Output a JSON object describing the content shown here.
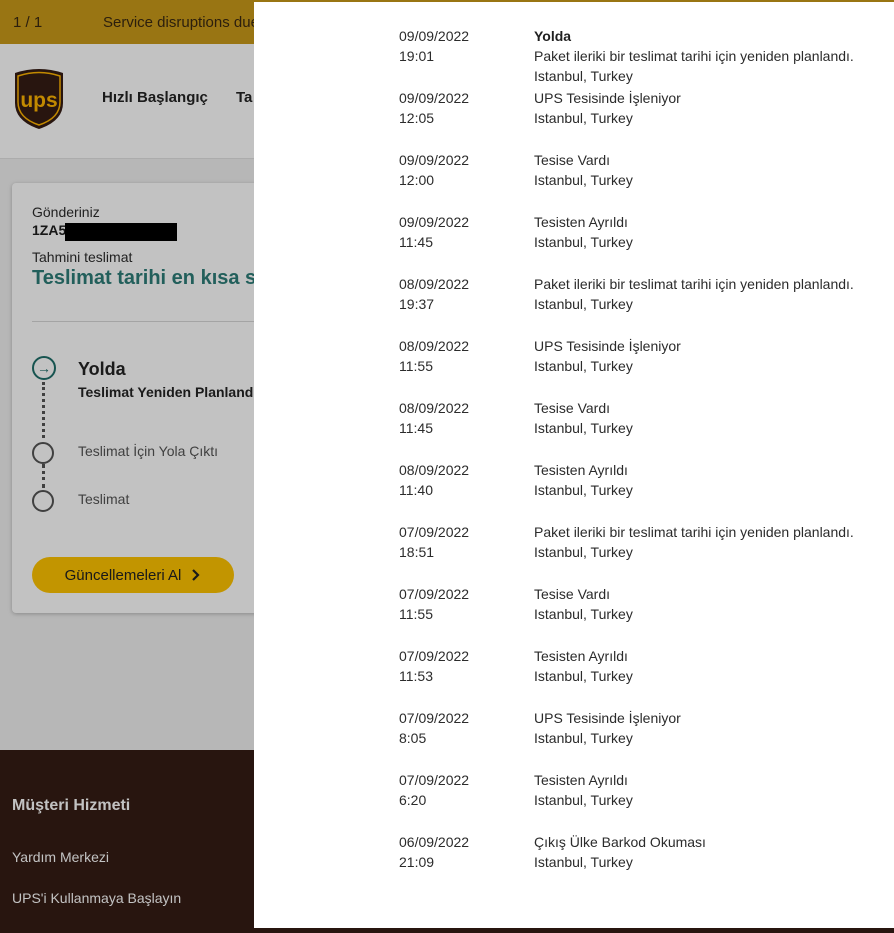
{
  "alert": {
    "counter": "1 / 1",
    "text": "Service disruptions due"
  },
  "header": {
    "nav": [
      "Hızlı Başlangıç",
      "Ta"
    ]
  },
  "card": {
    "shipment_label": "Gönderiniz",
    "tracking_visible": "1ZA5",
    "est_label": "Tahmini teslimat",
    "est_value": "Teslimat tarihi en kısa sü",
    "current_status": "Yolda",
    "current_sub": "Teslimat Yeniden Planland",
    "steps": [
      "Teslimat İçin Yola Çıktı",
      "Teslimat"
    ],
    "updates_button": "Güncellemeleri Al"
  },
  "footer": {
    "title": "Müşteri Hizmeti",
    "links": [
      "Yardım Merkezi",
      "UPS'i Kullanmaya Başlayın"
    ]
  },
  "events": [
    {
      "date": "09/09/2022",
      "time": "19:01",
      "status": "Yolda",
      "detail": "Paket ileriki bir teslimat tarihi için yeniden planlandı.",
      "location": "Istanbul, Turkey"
    },
    {
      "date": "09/09/2022",
      "time": "12:05",
      "status": "UPS Tesisinde İşleniyor",
      "detail": "",
      "location": "Istanbul, Turkey"
    },
    {
      "date": "09/09/2022",
      "time": "12:00",
      "status": "Tesise Vardı",
      "detail": "",
      "location": "Istanbul, Turkey"
    },
    {
      "date": "09/09/2022",
      "time": "11:45",
      "status": "Tesisten Ayrıldı",
      "detail": "",
      "location": "Istanbul, Turkey"
    },
    {
      "date": "08/09/2022",
      "time": "19:37",
      "status": "Paket ileriki bir teslimat tarihi için yeniden planlandı.",
      "detail": "",
      "location": "Istanbul, Turkey"
    },
    {
      "date": "08/09/2022",
      "time": "11:55",
      "status": "UPS Tesisinde İşleniyor",
      "detail": "",
      "location": "Istanbul, Turkey"
    },
    {
      "date": "08/09/2022",
      "time": "11:45",
      "status": "Tesise Vardı",
      "detail": "",
      "location": "Istanbul, Turkey"
    },
    {
      "date": "08/09/2022",
      "time": "11:40",
      "status": "Tesisten Ayrıldı",
      "detail": "",
      "location": "Istanbul, Turkey"
    },
    {
      "date": "07/09/2022",
      "time": "18:51",
      "status": "Paket ileriki bir teslimat tarihi için yeniden planlandı.",
      "detail": "",
      "location": "Istanbul, Turkey"
    },
    {
      "date": "07/09/2022",
      "time": "11:55",
      "status": "Tesise Vardı",
      "detail": "",
      "location": "Istanbul, Turkey"
    },
    {
      "date": "07/09/2022",
      "time": "11:53",
      "status": "Tesisten Ayrıldı",
      "detail": "",
      "location": "Istanbul, Turkey"
    },
    {
      "date": "07/09/2022",
      "time": "8:05",
      "status": "UPS Tesisinde İşleniyor",
      "detail": "",
      "location": "Istanbul, Turkey"
    },
    {
      "date": "07/09/2022",
      "time": "6:20",
      "status": "Tesisten Ayrıldı",
      "detail": "",
      "location": "Istanbul, Turkey"
    },
    {
      "date": "06/09/2022",
      "time": "21:09",
      "status": "Çıkış Ülke Barkod Okuması",
      "detail": "",
      "location": "Istanbul, Turkey"
    }
  ],
  "colors": {
    "brand_brown": "#351c15",
    "brand_gold": "#ffc400",
    "accent_teal": "#2d7d78",
    "alert_bar": "#c99a1a"
  },
  "icons": {
    "logo": "ups-shield-logo",
    "step_active": "arrow-right-circle-icon",
    "button": "chevron-right-icon"
  }
}
